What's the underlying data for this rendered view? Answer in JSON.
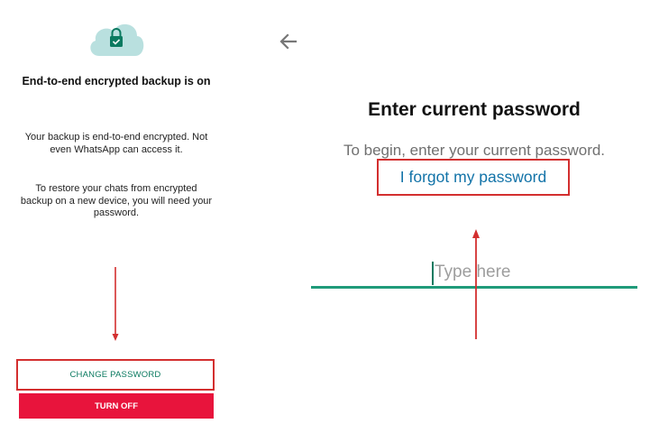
{
  "left": {
    "title": "End-to-end encrypted backup is on",
    "para1": "Your backup is end-to-end encrypted. Not even WhatsApp can access it.",
    "para2": "To restore your chats from encrypted backup on a new device, you will need your password.",
    "change_password_label": "CHANGE PASSWORD",
    "turn_off_label": "TURN OFF"
  },
  "right": {
    "title": "Enter current password",
    "subtitle": "To begin, enter your current password.",
    "forgot_link": "I forgot my password",
    "password_placeholder": "Type here"
  },
  "icons": {
    "cloud": "cloud-lock-icon",
    "back": "arrow-left-icon"
  },
  "colors": {
    "accent": "#0b7a60",
    "underline": "#1f9b7a",
    "danger": "#e8143c",
    "annotation": "#d32f2f",
    "cloud": "#b9e0df",
    "link": "#1273a8"
  }
}
